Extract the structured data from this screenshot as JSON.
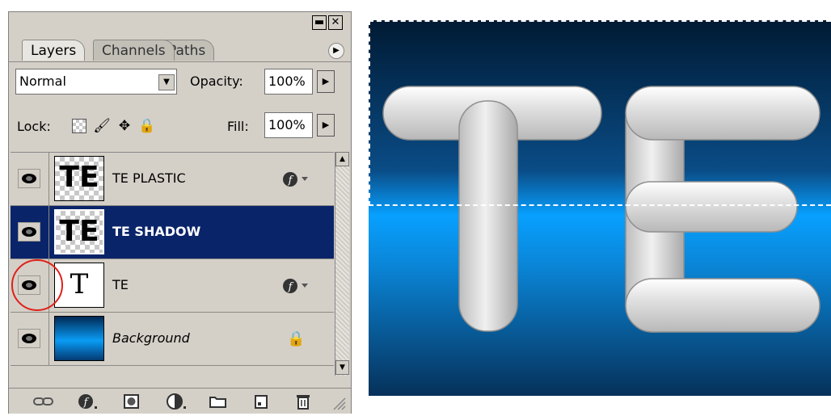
{
  "panel": {
    "tabs": [
      {
        "label": "Layers",
        "active": true
      },
      {
        "label": "Channels",
        "active": false
      },
      {
        "label": "Paths",
        "active": false
      }
    ],
    "blend_mode": "Normal",
    "opacity_label": "Opacity:",
    "opacity_value": "100%",
    "lock_label": "Lock:",
    "fill_label": "Fill:",
    "fill_value": "100%",
    "layers": [
      {
        "name": "TE PLASTIC",
        "thumb_text": "TE",
        "has_effects": true,
        "selected": false
      },
      {
        "name": "TE SHADOW",
        "thumb_text": "TE",
        "has_effects": false,
        "selected": true
      },
      {
        "name": "TE",
        "thumb_text": "T",
        "has_effects": true,
        "selected": false
      },
      {
        "name": "Background",
        "has_lock": true,
        "selected": false
      }
    ]
  },
  "canvas": {
    "text": "TE"
  },
  "colors": {
    "panel_bg": "#d4d0c8",
    "selection": "#0a246a",
    "highlight_ring": "#e0201a"
  }
}
